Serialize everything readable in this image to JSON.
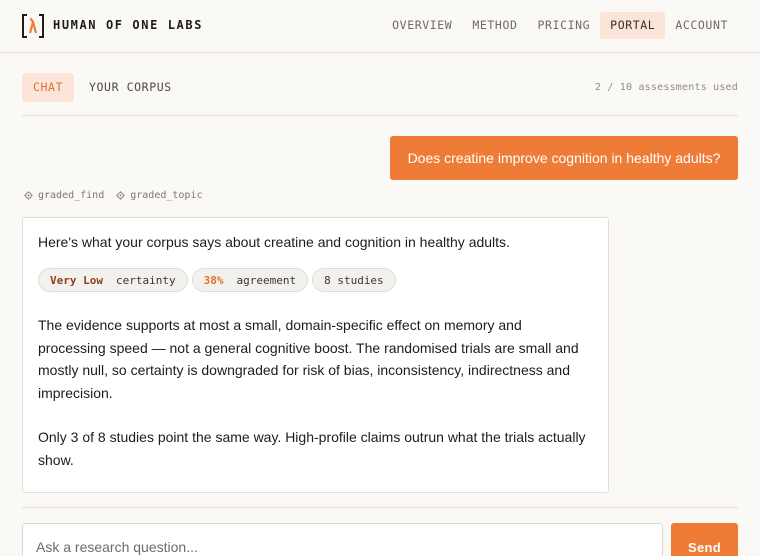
{
  "header": {
    "brand": "HUMAN OF ONE LABS",
    "logo_icon": "bracket-flame-logo",
    "nav": [
      {
        "label": "OVERVIEW",
        "active": false
      },
      {
        "label": "METHOD",
        "active": false
      },
      {
        "label": "PRICING",
        "active": false
      },
      {
        "label": "PORTAL",
        "active": true
      },
      {
        "label": "ACCOUNT",
        "active": false
      }
    ]
  },
  "tabs": [
    {
      "label": "CHAT",
      "active": true
    },
    {
      "label": "YOUR CORPUS",
      "active": false
    }
  ],
  "usage": "2 / 10 assessments used",
  "user_message": "Does creatine improve cognition in healthy adults?",
  "tools": [
    {
      "icon": "gear-icon",
      "label": "graded_find"
    },
    {
      "icon": "gear-icon",
      "label": "graded_topic"
    }
  ],
  "answer": {
    "intro": "Here's what your corpus says about creatine and cognition in healthy adults.",
    "certainty": {
      "value": "Very Low",
      "label": "certainty"
    },
    "agreement": {
      "value": "38%",
      "label": "agreement"
    },
    "studies": "8 studies",
    "paragraphs": [
      "The evidence supports at most a small, domain-specific effect on memory and processing speed — not a general cognitive boost. The randomised trials are small and mostly null, so certainty is downgraded for risk of bias, inconsistency, indirectness and imprecision.",
      "Only 3 of 8 studies point the same way. High-profile claims outrun what the trials actually show."
    ]
  },
  "composer": {
    "placeholder": "Ask a research question...",
    "send_label": "Send"
  },
  "colors": {
    "accent": "#ef7c36",
    "accent_soft": "#fbe5d8",
    "background": "#faf9f6"
  }
}
